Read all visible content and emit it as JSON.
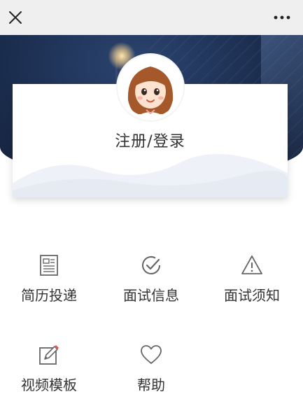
{
  "topbar": {
    "close_icon": "close-icon",
    "more_icon": "more-icon"
  },
  "profile": {
    "avatar": "avatar-girl",
    "login_label": "注册/登录"
  },
  "menu": [
    {
      "label": "简历投递",
      "icon": "resume-icon"
    },
    {
      "label": "面试信息",
      "icon": "check-circle-icon"
    },
    {
      "label": "面试须知",
      "icon": "warning-icon"
    },
    {
      "label": "视频模板",
      "icon": "edit-icon"
    },
    {
      "label": "帮助",
      "icon": "heart-icon"
    }
  ]
}
